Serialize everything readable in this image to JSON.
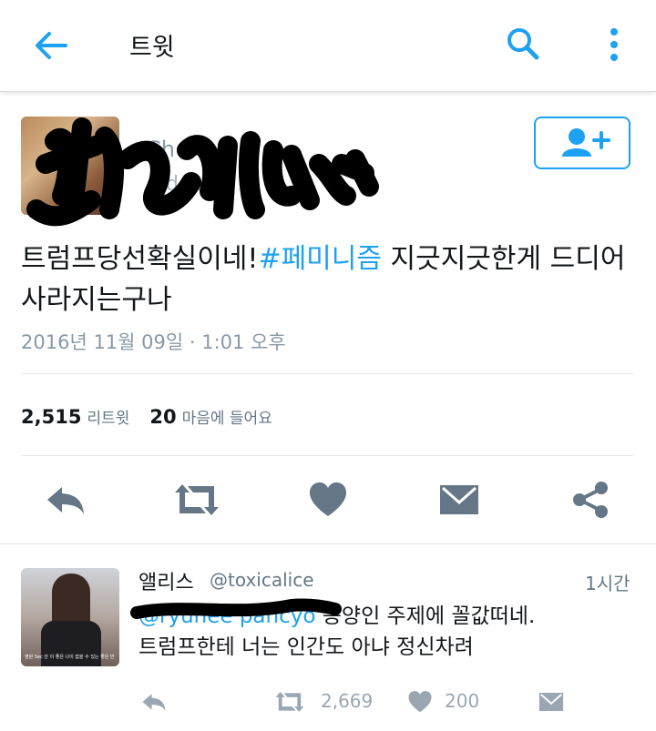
{
  "appbar": {
    "title": "트윗",
    "back_icon": "arrow-left-icon",
    "search_icon": "search-icon",
    "overflow_icon": "more-vertical-icon"
  },
  "tweet": {
    "author_name_obscured": "Ch",
    "author_handle_obscured": "@d  le  n",
    "follow_icon": "add-user-icon",
    "text_before": "트럼프당선확실이네!",
    "hashtag": "#페미니즘",
    "text_after": " 지긋지긋한게 드디어 사라지는구나",
    "timestamp": "2016년 11월 09일 · 1:01 오후",
    "stats": {
      "retweets": "2,515",
      "retweets_label": "리트윗",
      "likes": "20",
      "likes_label": "마음에 들어요"
    },
    "actions": [
      "reply-icon",
      "retweet-icon",
      "heart-icon",
      "direct-message-icon",
      "share-icon"
    ]
  },
  "reply": {
    "name": "앨리스",
    "handle": "@toxicalice",
    "time": "1시간",
    "mention_obscured": "@ryuhee  pancyo",
    "line1": "동양인 주제에 꼴값떠네.",
    "line2": "트럼프한테 너는 인간도 아냐 정신차려",
    "avatar_caption": "영원 Sec 안 이 좋은 나이 잡을 수 있는 좋은 반",
    "retweets": "2,669",
    "likes": "200"
  },
  "colors": {
    "accent": "#1da1f2",
    "icon_gray": "#657786",
    "muted": "#8899a6"
  }
}
